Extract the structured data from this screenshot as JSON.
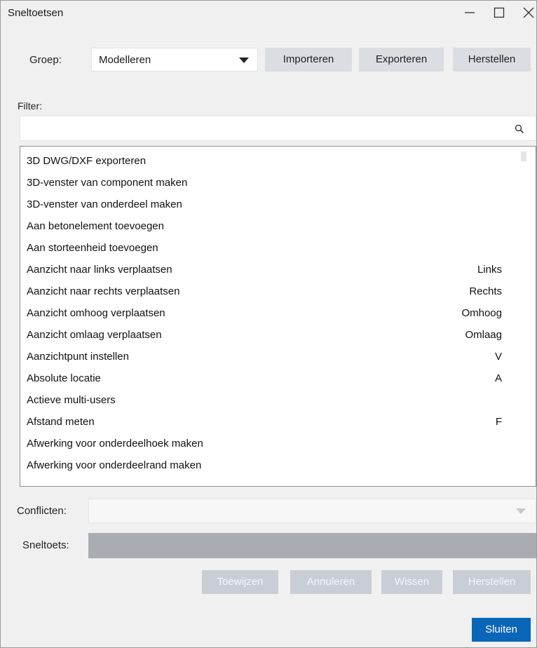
{
  "window": {
    "title": "Sneltoetsen"
  },
  "group": {
    "label": "Groep:",
    "selected": "Modelleren"
  },
  "toolbar": {
    "import": "Importeren",
    "export": "Exporteren",
    "reset": "Herstellen"
  },
  "filter": {
    "label": "Filter:",
    "value": "",
    "placeholder": ""
  },
  "commands": [
    {
      "name": "3D DWG/DXF exporteren",
      "key": ""
    },
    {
      "name": "3D-venster van component maken",
      "key": ""
    },
    {
      "name": "3D-venster van onderdeel maken",
      "key": ""
    },
    {
      "name": "Aan betonelement toevoegen",
      "key": ""
    },
    {
      "name": "Aan storteenheid toevoegen",
      "key": ""
    },
    {
      "name": "Aanzicht naar links verplaatsen",
      "key": "Links"
    },
    {
      "name": "Aanzicht naar rechts verplaatsen",
      "key": "Rechts"
    },
    {
      "name": "Aanzicht omhoog verplaatsen",
      "key": "Omhoog"
    },
    {
      "name": "Aanzicht omlaag verplaatsen",
      "key": "Omlaag"
    },
    {
      "name": "Aanzichtpunt instellen",
      "key": "V"
    },
    {
      "name": "Absolute locatie",
      "key": "A"
    },
    {
      "name": "Actieve multi-users",
      "key": ""
    },
    {
      "name": "Afstand meten",
      "key": "F"
    },
    {
      "name": "Afwerking voor onderdeelhoek maken",
      "key": ""
    },
    {
      "name": "Afwerking voor onderdeelrand maken",
      "key": ""
    }
  ],
  "conflicts": {
    "label": "Conflicten:",
    "value": ""
  },
  "shortcut": {
    "label": "Sneltoets:",
    "value": ""
  },
  "actions": {
    "assign": "Toewijzen",
    "cancel": "Annuleren",
    "clear": "Wissen",
    "reset": "Herstellen"
  },
  "close_label": "Sluiten",
  "colors": {
    "primary": "#0a66b8",
    "button": "#dadde2",
    "disabled_button": "#c9ced6",
    "field_disabled": "#a9adb3"
  }
}
